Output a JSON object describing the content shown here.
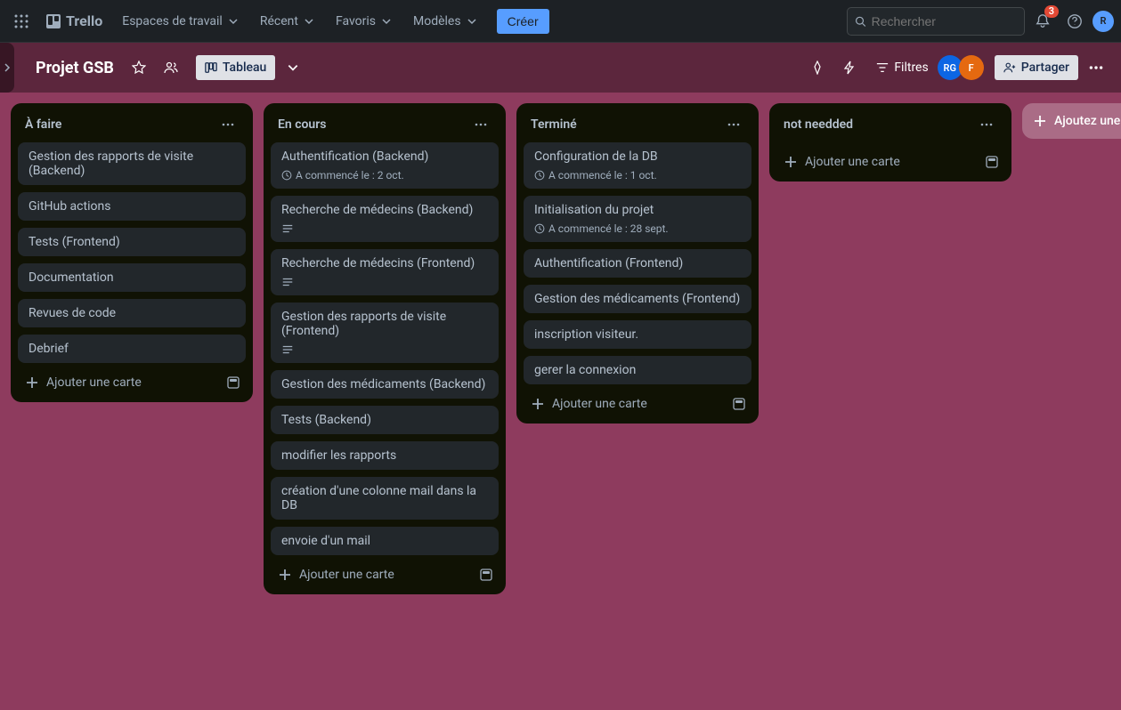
{
  "topbar": {
    "logo": "Trello",
    "nav": {
      "workspaces": "Espaces de travail",
      "recent": "Récent",
      "starred": "Favoris",
      "templates": "Modèles"
    },
    "create": "Créer",
    "search_placeholder": "Rechercher",
    "notif_count": "3"
  },
  "boardbar": {
    "title": "Projet GSB",
    "view_label": "Tableau",
    "filters": "Filtres",
    "share": "Partager",
    "members": [
      {
        "initials": "RG",
        "color": "#0c66e4"
      },
      {
        "initials": "F",
        "color": "#e56910"
      }
    ]
  },
  "add_card_label": "Ajouter une carte",
  "add_list_label": "Ajoutez une autre liste",
  "lists": [
    {
      "title": "À faire",
      "cards": [
        {
          "title": "Gestion des rapports de visite (Backend)"
        },
        {
          "title": "GitHub actions"
        },
        {
          "title": "Tests (Frontend)"
        },
        {
          "title": "Documentation"
        },
        {
          "title": "Revues de code"
        },
        {
          "title": "Debrief"
        }
      ]
    },
    {
      "title": "En cours",
      "cards": [
        {
          "title": "Authentification (Backend)",
          "date": "A commencé le : 2 oct."
        },
        {
          "title": "Recherche de médecins (Backend)",
          "desc": true
        },
        {
          "title": "Recherche de médecins (Frontend)",
          "desc": true
        },
        {
          "title": "Gestion des rapports de visite (Frontend)",
          "desc": true
        },
        {
          "title": "Gestion des médicaments (Backend)"
        },
        {
          "title": "Tests (Backend)"
        },
        {
          "title": "modifier les rapports"
        },
        {
          "title": "création d'une colonne mail dans la DB"
        },
        {
          "title": "envoie d'un mail"
        }
      ]
    },
    {
      "title": "Terminé",
      "cards": [
        {
          "title": "Configuration de la DB",
          "date": "A commencé le : 1 oct."
        },
        {
          "title": "Initialisation du projet",
          "date": "A commencé le : 28 sept."
        },
        {
          "title": "Authentification (Frontend)"
        },
        {
          "title": "Gestion des médicaments (Frontend)"
        },
        {
          "title": "inscription visiteur."
        },
        {
          "title": "gerer la connexion"
        }
      ]
    },
    {
      "title": "not needded",
      "cards": []
    }
  ]
}
